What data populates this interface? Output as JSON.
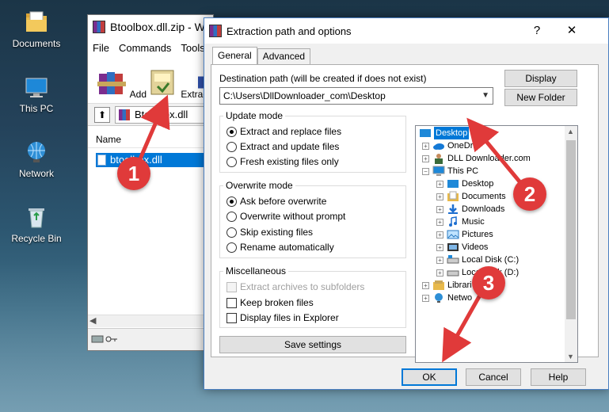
{
  "desktop": {
    "icons": [
      {
        "label": "Documents",
        "icon": "folder-documents-icon"
      },
      {
        "label": "This PC",
        "icon": "computer-icon"
      },
      {
        "label": "Network",
        "icon": "network-icon"
      },
      {
        "label": "Recycle Bin",
        "icon": "recycle-bin-icon"
      }
    ]
  },
  "winrar": {
    "title": "Btoolbox.dll.zip - Wi",
    "menu": [
      "File",
      "Commands",
      "Tools"
    ],
    "toolbar": [
      {
        "label": "Add",
        "icon": "rar-books-icon"
      },
      {
        "label": "Extract To",
        "icon": "extract-folder-icon"
      },
      {
        "label": "T",
        "icon": "test-icon"
      }
    ],
    "address": "Btoolbox.dll",
    "column_name": "Name",
    "file": "btoolbox.dll"
  },
  "dialog": {
    "title": "Extraction path and options",
    "help_glyph": "?",
    "close_glyph": "✕",
    "tabs": [
      "General",
      "Advanced"
    ],
    "destination_label": "Destination path (will be created if does not exist)",
    "destination_value": "C:\\Users\\DllDownloader_com\\Desktop",
    "display_button": "Display",
    "new_folder_button": "New Folder",
    "update_mode": {
      "title": "Update mode",
      "options": [
        "Extract and replace files",
        "Extract and update files",
        "Fresh existing files only"
      ],
      "selected": 0
    },
    "overwrite_mode": {
      "title": "Overwrite mode",
      "options": [
        "Ask before overwrite",
        "Overwrite without prompt",
        "Skip existing files",
        "Rename automatically"
      ],
      "selected": 0
    },
    "misc": {
      "title": "Miscellaneous",
      "options": [
        {
          "label": "Extract archives to subfolders",
          "checked": false,
          "disabled": true
        },
        {
          "label": "Keep broken files",
          "checked": false,
          "disabled": false
        },
        {
          "label": "Display files in Explorer",
          "checked": false,
          "disabled": false
        }
      ]
    },
    "save_settings": "Save settings",
    "tree": [
      {
        "label": "Desktop",
        "icon": "desktop-folder-icon",
        "selected": true
      },
      {
        "label": "OneDri",
        "icon": "onedrive-cloud-icon"
      },
      {
        "label": "DLL Downloader.com",
        "icon": "user-folder-icon"
      },
      {
        "label": "This PC",
        "icon": "computer-icon"
      },
      {
        "label": "Desktop",
        "icon": "desktop-folder-icon"
      },
      {
        "label": "Documents",
        "icon": "documents-folder-icon"
      },
      {
        "label": "Downloads",
        "icon": "downloads-folder-icon"
      },
      {
        "label": "Music",
        "icon": "music-folder-icon"
      },
      {
        "label": "Pictures",
        "icon": "pictures-folder-icon"
      },
      {
        "label": "Videos",
        "icon": "videos-folder-icon"
      },
      {
        "label": "Local Disk (C:)",
        "icon": "drive-icon"
      },
      {
        "label": "Local Disk (D:)",
        "icon": "drive-icon"
      },
      {
        "label": "Librari",
        "icon": "libraries-icon"
      },
      {
        "label": "Netwo",
        "icon": "network-icon"
      }
    ],
    "ok": "OK",
    "cancel": "Cancel",
    "help": "Help"
  },
  "annotations": [
    "1",
    "2",
    "3"
  ],
  "colors": {
    "selection": "#0078d7",
    "annotation": "#e03a3a"
  }
}
